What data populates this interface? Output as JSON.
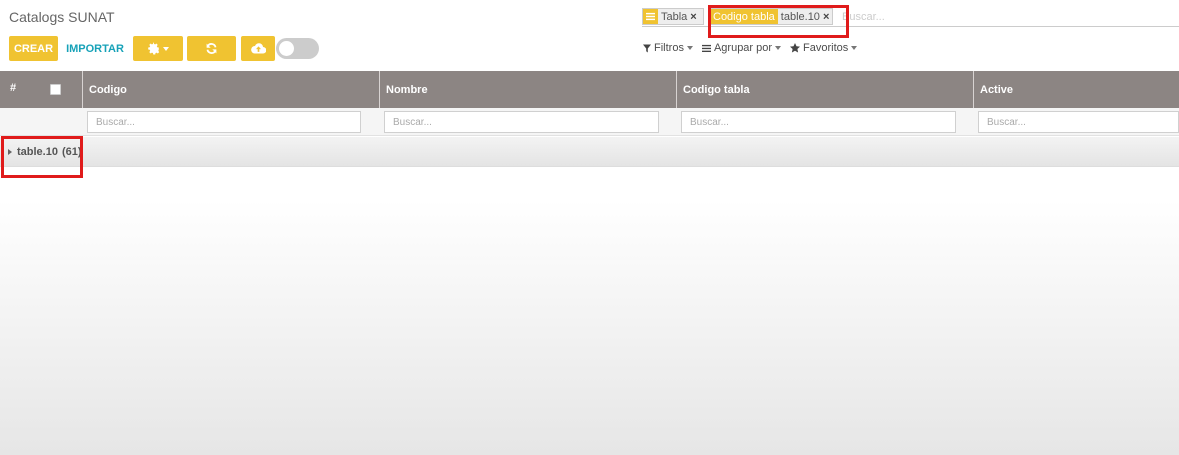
{
  "page": {
    "title": "Catalogs SUNAT"
  },
  "toolbar": {
    "create_label": "CREAR",
    "import_label": "IMPORTAR",
    "icons": {
      "gear": "gear-icon",
      "refresh": "refresh-icon",
      "cloud": "cloud-upload-icon"
    },
    "accent_color": "#f0c331"
  },
  "search": {
    "facets": [
      {
        "label": "Tabla",
        "remove": "×"
      },
      {
        "label": "Codigo tabla",
        "value": "table.10",
        "remove": "×"
      }
    ],
    "placeholder": "Buscar..."
  },
  "filters": {
    "filtros": "Filtros",
    "agrupar": "Agrupar por",
    "favoritos": "Favoritos"
  },
  "table": {
    "columns": {
      "hash": "#",
      "codigo": "Codigo",
      "nombre": "Nombre",
      "codigo_tabla": "Codigo tabla",
      "active": "Active"
    },
    "filter_placeholder": "Buscar...",
    "groups": [
      {
        "label": "table.10",
        "count": "(61)"
      }
    ]
  },
  "highlight_color": "#e01b1b"
}
